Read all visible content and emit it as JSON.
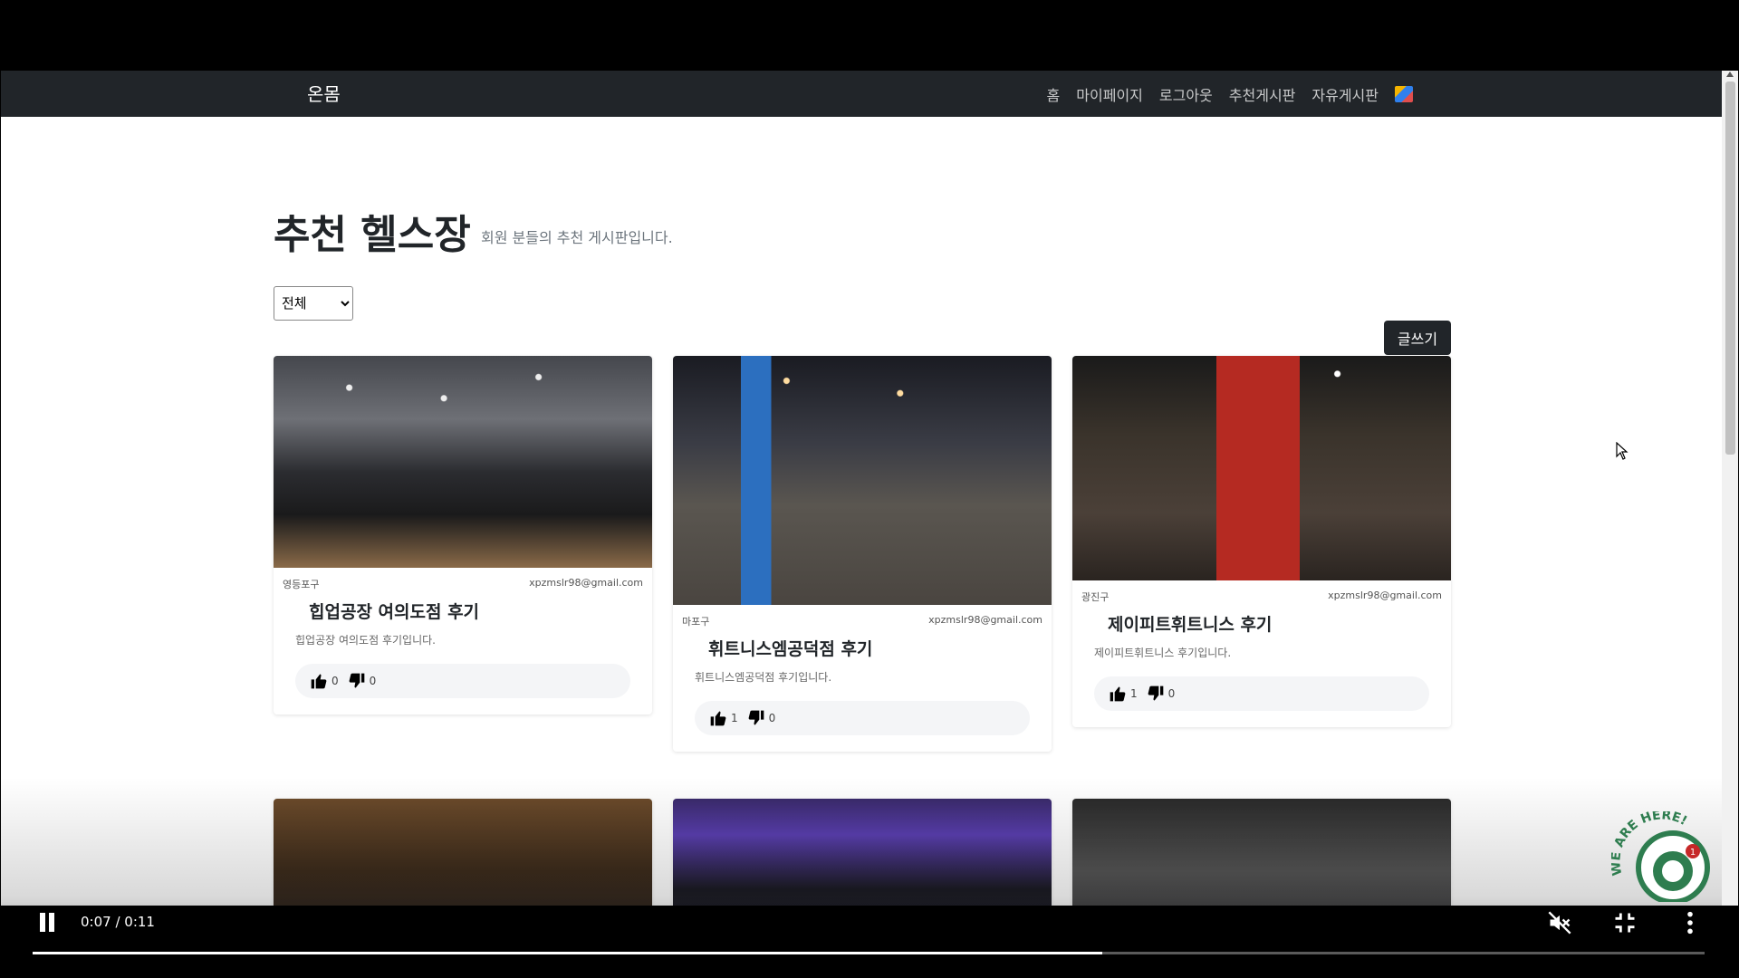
{
  "navbar": {
    "brand": "온몸",
    "items": [
      {
        "label": "홈"
      },
      {
        "label": "마이페이지"
      },
      {
        "label": "로그아웃"
      },
      {
        "label": "추천게시판"
      },
      {
        "label": "자유게시판"
      }
    ]
  },
  "page": {
    "title": "추천 헬스장",
    "subtitle": "회원 분들의 추천 게시판입니다.",
    "region_filter": {
      "selected": "전체"
    },
    "write_button": "글쓰기"
  },
  "cards": [
    {
      "region": "영등포구",
      "email": "xpzmslr98@gmail.com",
      "title": "힙업공장 여의도점 후기",
      "desc": "힙업공장 여의도점 후기입니다.",
      "likes": "0",
      "dislikes": "0"
    },
    {
      "region": "마포구",
      "email": "xpzmslr98@gmail.com",
      "title": "휘트니스엠공덕점 후기",
      "desc": "휘트니스엠공덕점 후기입니다.",
      "likes": "1",
      "dislikes": "0"
    },
    {
      "region": "광진구",
      "email": "xpzmslr98@gmail.com",
      "title": "제이피트휘트니스 후기",
      "desc": "제이피트휘트니스 후기입니다.",
      "likes": "1",
      "dislikes": "0"
    }
  ],
  "player": {
    "time": "0:07 / 0:11",
    "progress": 0.64,
    "icons": [
      "pause-icon",
      "mute-icon",
      "exit-fullscreen-icon",
      "more-options-icon"
    ]
  },
  "chat_widget": {
    "text": "WE ARE HERE!",
    "badge": "1"
  },
  "colors": {
    "navbar": "#212529",
    "button": "#212529",
    "chat": "#2e7d4f"
  }
}
